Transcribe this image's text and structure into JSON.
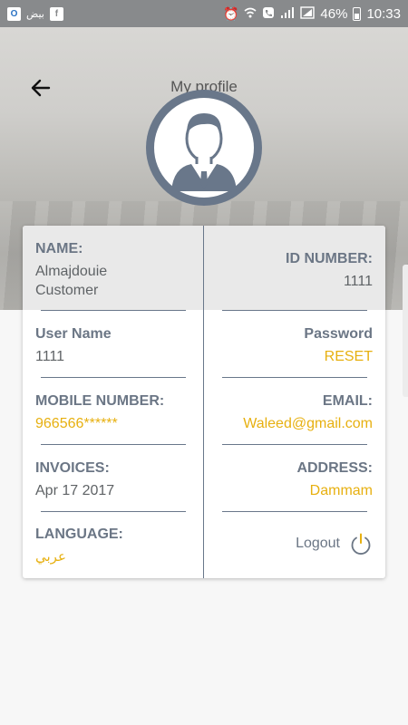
{
  "status_bar": {
    "outlook_icon": "outlook-icon",
    "arabic_text": "بيض",
    "battery": "46%",
    "time": "10:33",
    "icons": [
      "alarm-icon",
      "wifi-call-icon",
      "phone-icon",
      "signal-icon",
      "signal-2-icon",
      "battery-icon"
    ]
  },
  "header": {
    "title": "My profile",
    "back_icon": "back-arrow-icon",
    "avatar_icon": "user-avatar-icon"
  },
  "profile": {
    "name_label": "NAME:",
    "name_line1": "Almajdouie",
    "name_line2": "Customer",
    "id_label": "ID NUMBER:",
    "id_value": "1111",
    "username_label": "User Name",
    "username_value": "1111",
    "password_label": "Password",
    "password_action": "RESET",
    "mobile_label": "MOBILE NUMBER:",
    "mobile_value": "966566******",
    "email_label": "EMAIL:",
    "email_value": "Waleed@gmail.com",
    "invoices_label": "INVOICES:",
    "invoices_value": "Apr 17 2017",
    "address_label": "ADDRESS:",
    "address_value": "Dammam",
    "language_label": "LANGUAGE:",
    "language_value": "عربي",
    "logout_label": "Logout",
    "logout_icon": "power-icon"
  },
  "colors": {
    "accent": "#e7b010",
    "label": "#6b7685",
    "divider": "#69778a",
    "avatar_bg": "#69778a"
  }
}
